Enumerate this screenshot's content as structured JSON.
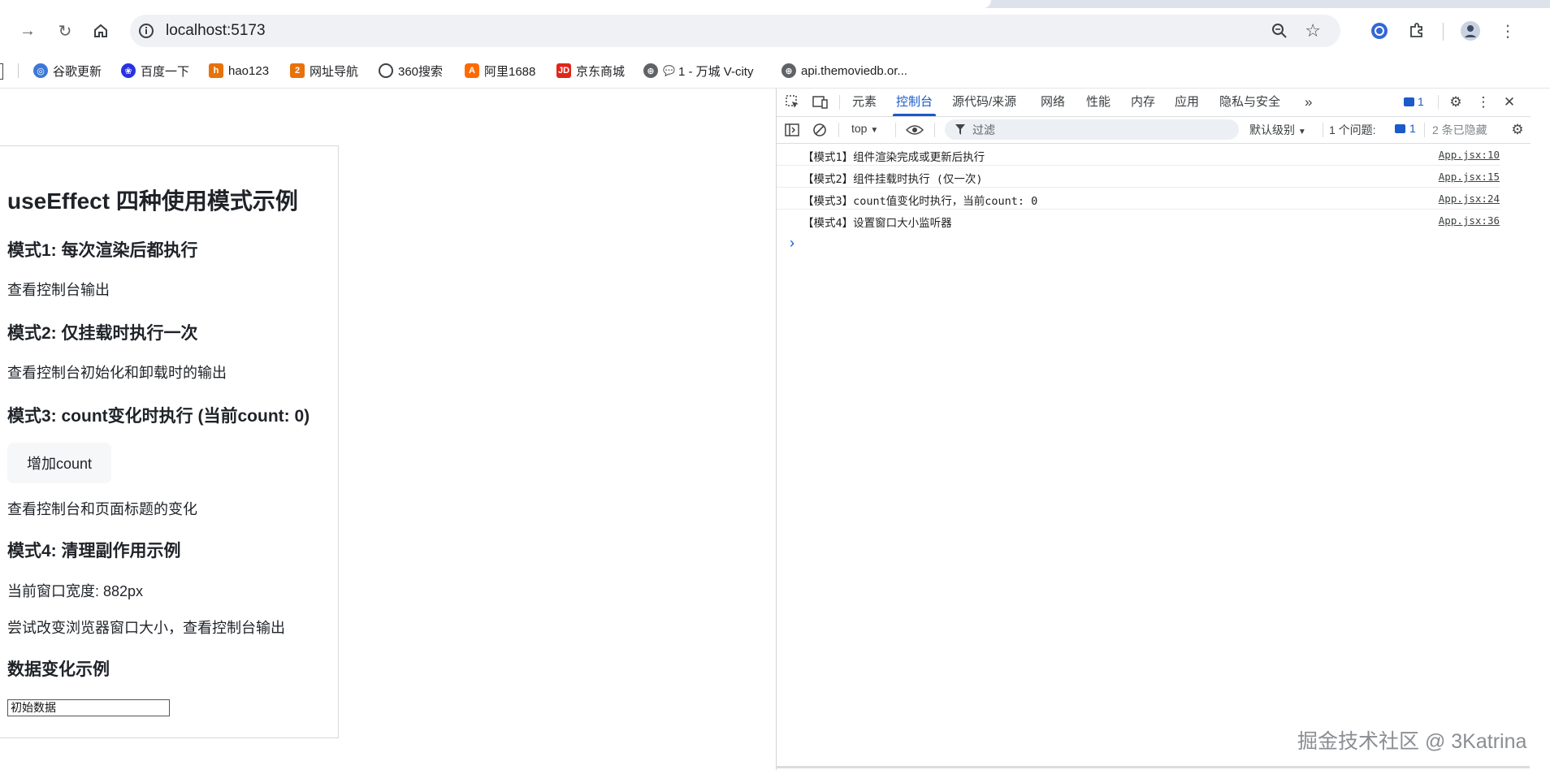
{
  "browser": {
    "url": "localhost:5173",
    "bookmarks": [
      {
        "label": "谷歌更新",
        "icon": "chrome-icon",
        "color": "#3c78d8"
      },
      {
        "label": "百度一下",
        "icon": "baidu-paw-icon",
        "color": "#2932e1"
      },
      {
        "label": "hao123",
        "icon": "hao123-icon",
        "color": "#e8710a"
      },
      {
        "label": "网址导航",
        "icon": "2345-icon",
        "color": "#e8710a"
      },
      {
        "label": "360搜索",
        "icon": "360-icon",
        "color": "#3c9a3c"
      },
      {
        "label": "阿里1688",
        "icon": "1688-icon",
        "color": "#ff6a00"
      },
      {
        "label": "京东商城",
        "icon": "jd-icon",
        "color": "#e1251b"
      },
      {
        "label": "1 - 万城 V-city",
        "icon": "globe-icon",
        "color": "#5f6368"
      },
      {
        "label": "api.themoviedb.or...",
        "icon": "globe-icon",
        "color": "#5f6368"
      }
    ]
  },
  "page": {
    "title": "useEffect 四种使用模式示例",
    "mode1": {
      "heading": "模式1: 每次渲染后都执行",
      "text": "查看控制台输出"
    },
    "mode2": {
      "heading": "模式2: 仅挂载时执行一次",
      "text": "查看控制台初始化和卸载时的输出"
    },
    "mode3": {
      "heading": "模式3: count变化时执行 (当前count: 0)",
      "button": "增加count",
      "text": "查看控制台和页面标题的变化"
    },
    "mode4": {
      "heading": "模式4: 清理副作用示例",
      "width_text": "当前窗口宽度: 882px",
      "text": "尝试改变浏览器窗口大小，查看控制台输出"
    },
    "data": {
      "heading": "数据变化示例",
      "input_value": "初始数据"
    }
  },
  "devtools": {
    "tabs": [
      "元素",
      "控制台",
      "源代码/来源",
      "网络",
      "性能",
      "内存",
      "应用",
      "隐私与安全"
    ],
    "active_tab": "控制台",
    "issues_badge": "1",
    "console_bar": {
      "context": "top",
      "filter_placeholder": "过滤",
      "level": "默认级别",
      "issues_label": "1 个问题:",
      "issues_count": "1",
      "hidden": "2 条已隐藏"
    },
    "logs": [
      {
        "message": "【模式1】组件渲染完成或更新后执行",
        "source": "App.jsx:10"
      },
      {
        "message": "【模式2】组件挂载时执行 (仅一次)",
        "source": "App.jsx:15"
      },
      {
        "message": "【模式3】count值变化时执行，当前count: 0",
        "source": "App.jsx:24"
      },
      {
        "message": "【模式4】设置窗口大小监听器",
        "source": "App.jsx:36"
      }
    ]
  },
  "watermark": "掘金技术社区 @ 3Katrina",
  "colors": {
    "accent": "#1a5ac9",
    "omnibox": "#eff1f5"
  }
}
